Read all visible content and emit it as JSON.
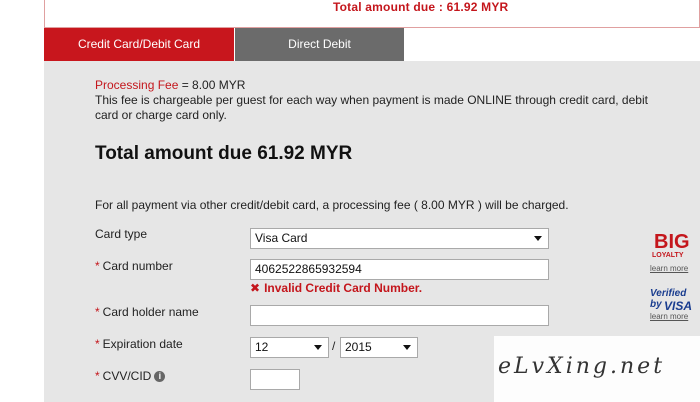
{
  "header": {
    "total_due": "Total amount due :   61.92 MYR"
  },
  "tabs": [
    {
      "label": "Credit Card/Debit Card",
      "active": true
    },
    {
      "label": "Direct Debit",
      "active": false
    }
  ],
  "fee": {
    "label": "Processing Fee",
    "value": " = 8.00 MYR",
    "description": "This fee is chargeable per guest for each way when payment is made ONLINE through credit card, debit card or charge card only."
  },
  "summary": {
    "total_due": "Total amount due 61.92 MYR"
  },
  "notice": "For all payment via other credit/debit card, a processing fee ( 8.00 MYR ) will be charged.",
  "form": {
    "card_type": {
      "label": "Card type",
      "value": "Visa Card"
    },
    "card_number": {
      "label": "Card number",
      "value": "4062522865932594",
      "error": "Invalid Credit Card Number."
    },
    "card_holder": {
      "label": "Card holder name",
      "value": ""
    },
    "expiration": {
      "label": "Expiration date",
      "month": "12",
      "year": "2015",
      "separator": "/"
    },
    "cvv": {
      "label": "CVV/CID",
      "value": ""
    },
    "required_marker": "*"
  },
  "side": {
    "big_logo": "BIG",
    "loyalty": "LOYALTY",
    "learn_more_1": "learn more",
    "verified_by": "Verified by",
    "visa": "VISA",
    "learn_more_2": "learn more"
  },
  "watermark": "eLvXing.net",
  "colors": {
    "accent": "#c8161d",
    "inactive_tab": "#6b6b6b",
    "panel": "#e6e6e6",
    "error": "#c4161c"
  }
}
